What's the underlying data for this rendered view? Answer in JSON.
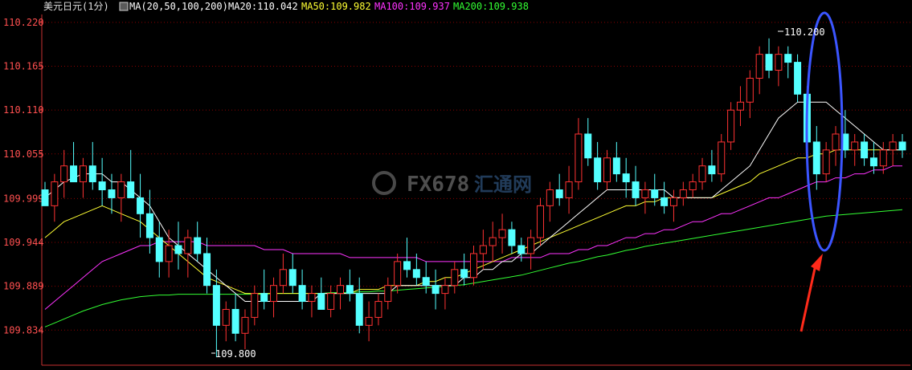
{
  "header": {
    "symbol_label": "美元日元(1分)",
    "ma_label": "MA(20,50,100,200)",
    "ma20_label": "MA20:110.042",
    "ma50_label": "MA50:109.982",
    "ma100_label": "MA100:109.937",
    "ma200_label": "MA200:109.938"
  },
  "watermark": {
    "text": "FX678",
    "cn": "汇通网"
  },
  "annotations": {
    "high_label": "110.200",
    "low_label": "109.800"
  },
  "chart_data": {
    "type": "candlestick",
    "title": "美元日元(1分)",
    "y_ticks": [
      "110.220",
      "110.165",
      "110.110",
      "110.055",
      "109.999",
      "109.944",
      "109.889",
      "109.834"
    ],
    "ylim": [
      109.79,
      110.23
    ],
    "grid": true,
    "colors": {
      "up": "#ff3232",
      "down": "#54ffff",
      "ma20": "#ffffff",
      "ma50": "#ffff33",
      "ma100": "#ff33ff",
      "ma200": "#33ff33",
      "axis": "#c83030",
      "grid": "#8c0000",
      "tick": "#ff5050",
      "circle": "#3b55ff",
      "arrow": "#ff2a1a"
    },
    "candles": [
      [
        110.01,
        110.02,
        109.99,
        109.99
      ],
      [
        109.99,
        110.03,
        109.97,
        110.02
      ],
      [
        110.02,
        110.06,
        110.0,
        110.04
      ],
      [
        110.04,
        110.07,
        110.02,
        110.02
      ],
      [
        110.02,
        110.05,
        110.0,
        110.04
      ],
      [
        110.04,
        110.07,
        110.01,
        110.02
      ],
      [
        110.02,
        110.05,
        109.99,
        110.01
      ],
      [
        110.01,
        110.03,
        109.98,
        110.0
      ],
      [
        110.0,
        110.03,
        109.97,
        110.02
      ],
      [
        110.02,
        110.06,
        110.0,
        110.0
      ],
      [
        110.0,
        110.03,
        109.95,
        109.98
      ],
      [
        109.98,
        110.01,
        109.93,
        109.95
      ],
      [
        109.95,
        109.97,
        109.9,
        109.92
      ],
      [
        109.92,
        109.96,
        109.9,
        109.94
      ],
      [
        109.94,
        109.97,
        109.91,
        109.93
      ],
      [
        109.93,
        109.96,
        109.9,
        109.95
      ],
      [
        109.95,
        109.97,
        109.92,
        109.93
      ],
      [
        109.93,
        109.95,
        109.88,
        109.89
      ],
      [
        109.89,
        109.91,
        109.8,
        109.84
      ],
      [
        109.84,
        109.87,
        109.82,
        109.86
      ],
      [
        109.86,
        109.88,
        109.82,
        109.83
      ],
      [
        109.83,
        109.86,
        109.81,
        109.85
      ],
      [
        109.85,
        109.89,
        109.84,
        109.88
      ],
      [
        109.88,
        109.91,
        109.86,
        109.87
      ],
      [
        109.87,
        109.9,
        109.85,
        109.89
      ],
      [
        109.89,
        109.93,
        109.88,
        109.91
      ],
      [
        109.91,
        109.93,
        109.88,
        109.89
      ],
      [
        109.89,
        109.91,
        109.86,
        109.87
      ],
      [
        109.87,
        109.89,
        109.85,
        109.88
      ],
      [
        109.88,
        109.9,
        109.86,
        109.86
      ],
      [
        109.86,
        109.89,
        109.85,
        109.88
      ],
      [
        109.88,
        109.9,
        109.86,
        109.89
      ],
      [
        109.89,
        109.91,
        109.87,
        109.88
      ],
      [
        109.88,
        109.9,
        109.83,
        109.84
      ],
      [
        109.84,
        109.87,
        109.82,
        109.85
      ],
      [
        109.85,
        109.88,
        109.84,
        109.87
      ],
      [
        109.87,
        109.9,
        109.86,
        109.89
      ],
      [
        109.89,
        109.93,
        109.88,
        109.92
      ],
      [
        109.92,
        109.95,
        109.9,
        109.91
      ],
      [
        109.91,
        109.93,
        109.89,
        109.9
      ],
      [
        109.9,
        109.92,
        109.88,
        109.89
      ],
      [
        109.89,
        109.91,
        109.86,
        109.88
      ],
      [
        109.88,
        109.9,
        109.86,
        109.89
      ],
      [
        109.89,
        109.92,
        109.88,
        109.91
      ],
      [
        109.91,
        109.93,
        109.89,
        109.9
      ],
      [
        109.9,
        109.94,
        109.89,
        109.93
      ],
      [
        109.93,
        109.96,
        109.91,
        109.94
      ],
      [
        109.94,
        109.97,
        109.92,
        109.95
      ],
      [
        109.95,
        109.98,
        109.93,
        109.96
      ],
      [
        109.96,
        109.97,
        109.93,
        109.94
      ],
      [
        109.94,
        109.95,
        109.92,
        109.93
      ],
      [
        109.93,
        109.96,
        109.91,
        109.95
      ],
      [
        109.95,
        110.0,
        109.94,
        109.99
      ],
      [
        109.99,
        110.02,
        109.97,
        110.01
      ],
      [
        110.01,
        110.03,
        109.99,
        110.0
      ],
      [
        110.0,
        110.04,
        109.98,
        110.02
      ],
      [
        110.02,
        110.1,
        110.01,
        110.08
      ],
      [
        110.08,
        110.1,
        110.04,
        110.05
      ],
      [
        110.05,
        110.07,
        110.01,
        110.02
      ],
      [
        110.02,
        110.06,
        110.01,
        110.05
      ],
      [
        110.05,
        110.07,
        110.02,
        110.03
      ],
      [
        110.03,
        110.05,
        110.0,
        110.02
      ],
      [
        110.02,
        110.04,
        109.99,
        110.0
      ],
      [
        110.0,
        110.02,
        109.98,
        110.01
      ],
      [
        110.01,
        110.03,
        109.99,
        110.0
      ],
      [
        110.0,
        110.02,
        109.98,
        109.99
      ],
      [
        109.99,
        110.01,
        109.97,
        110.0
      ],
      [
        110.0,
        110.02,
        109.99,
        110.01
      ],
      [
        110.01,
        110.03,
        110.0,
        110.02
      ],
      [
        110.02,
        110.05,
        110.01,
        110.04
      ],
      [
        110.04,
        110.06,
        110.02,
        110.03
      ],
      [
        110.03,
        110.08,
        110.02,
        110.07
      ],
      [
        110.07,
        110.12,
        110.06,
        110.11
      ],
      [
        110.11,
        110.14,
        110.09,
        110.12
      ],
      [
        110.12,
        110.16,
        110.1,
        110.15
      ],
      [
        110.15,
        110.19,
        110.13,
        110.18
      ],
      [
        110.18,
        110.2,
        110.15,
        110.16
      ],
      [
        110.16,
        110.19,
        110.14,
        110.18
      ],
      [
        110.18,
        110.19,
        110.15,
        110.17
      ],
      [
        110.17,
        110.18,
        110.12,
        110.13
      ],
      [
        110.13,
        110.14,
        110.05,
        110.07
      ],
      [
        110.07,
        110.09,
        110.01,
        110.03
      ],
      [
        110.03,
        110.07,
        110.02,
        110.06
      ],
      [
        110.06,
        110.09,
        110.04,
        110.08
      ],
      [
        110.08,
        110.11,
        110.05,
        110.06
      ],
      [
        110.06,
        110.08,
        110.04,
        110.07
      ],
      [
        110.07,
        110.08,
        110.04,
        110.05
      ],
      [
        110.05,
        110.07,
        110.03,
        110.04
      ],
      [
        110.04,
        110.07,
        110.03,
        110.06
      ],
      [
        110.06,
        110.08,
        110.04,
        110.07
      ],
      [
        110.07,
        110.08,
        110.05,
        110.06
      ]
    ],
    "ma20": [
      110.0,
      110.01,
      110.02,
      110.025,
      110.03,
      110.03,
      110.03,
      110.02,
      110.02,
      110.01,
      110.0,
      109.99,
      109.97,
      109.95,
      109.94,
      109.93,
      109.92,
      109.91,
      109.9,
      109.89,
      109.88,
      109.87,
      109.87,
      109.87,
      109.87,
      109.87,
      109.87,
      109.87,
      109.87,
      109.88,
      109.88,
      109.88,
      109.88,
      109.88,
      109.88,
      109.88,
      109.88,
      109.89,
      109.89,
      109.89,
      109.89,
      109.89,
      109.89,
      109.89,
      109.9,
      109.9,
      109.91,
      109.91,
      109.92,
      109.92,
      109.93,
      109.93,
      109.94,
      109.95,
      109.96,
      109.97,
      109.98,
      109.99,
      110.0,
      110.01,
      110.01,
      110.01,
      110.01,
      110.01,
      110.01,
      110.01,
      110.0,
      110.0,
      110.0,
      110.0,
      110.0,
      110.01,
      110.02,
      110.03,
      110.04,
      110.06,
      110.08,
      110.1,
      110.11,
      110.12,
      110.12,
      110.12,
      110.12,
      110.11,
      110.1,
      110.09,
      110.08,
      110.07,
      110.06,
      110.06,
      110.06
    ],
    "ma50": [
      109.95,
      109.96,
      109.97,
      109.975,
      109.98,
      109.985,
      109.99,
      109.985,
      109.98,
      109.975,
      109.97,
      109.96,
      109.95,
      109.94,
      109.93,
      109.92,
      109.91,
      109.9,
      109.895,
      109.89,
      109.885,
      109.88,
      109.88,
      109.88,
      109.88,
      109.88,
      109.88,
      109.88,
      109.88,
      109.88,
      109.88,
      109.88,
      109.88,
      109.885,
      109.885,
      109.885,
      109.89,
      109.89,
      109.89,
      109.89,
      109.895,
      109.895,
      109.9,
      109.9,
      109.905,
      109.91,
      109.915,
      109.92,
      109.925,
      109.93,
      109.935,
      109.94,
      109.945,
      109.95,
      109.955,
      109.96,
      109.965,
      109.97,
      109.975,
      109.98,
      109.985,
      109.99,
      109.99,
      109.995,
      109.995,
      110.0,
      110.0,
      110.0,
      110.0,
      110.0,
      110.0,
      110.005,
      110.01,
      110.015,
      110.02,
      110.03,
      110.035,
      110.04,
      110.045,
      110.05,
      110.05,
      110.055,
      110.055,
      110.06,
      110.06,
      110.06,
      110.06,
      110.06,
      110.06,
      110.06,
      110.06
    ],
    "ma100": [
      109.86,
      109.87,
      109.88,
      109.89,
      109.9,
      109.91,
      109.92,
      109.925,
      109.93,
      109.935,
      109.94,
      109.94,
      109.945,
      109.945,
      109.945,
      109.945,
      109.945,
      109.94,
      109.94,
      109.94,
      109.94,
      109.94,
      109.94,
      109.935,
      109.935,
      109.935,
      109.93,
      109.93,
      109.93,
      109.93,
      109.93,
      109.93,
      109.925,
      109.925,
      109.925,
      109.925,
      109.925,
      109.925,
      109.925,
      109.925,
      109.92,
      109.92,
      109.92,
      109.92,
      109.92,
      109.92,
      109.92,
      109.92,
      109.92,
      109.925,
      109.925,
      109.925,
      109.925,
      109.93,
      109.93,
      109.93,
      109.935,
      109.935,
      109.94,
      109.94,
      109.945,
      109.95,
      109.95,
      109.955,
      109.955,
      109.96,
      109.96,
      109.965,
      109.97,
      109.97,
      109.975,
      109.98,
      109.98,
      109.985,
      109.99,
      109.995,
      110.0,
      110.0,
      110.005,
      110.01,
      110.015,
      110.02,
      110.02,
      110.025,
      110.025,
      110.03,
      110.03,
      110.035,
      110.035,
      110.04,
      110.04
    ],
    "ma200": [
      109.838,
      109.843,
      109.848,
      109.853,
      109.858,
      109.862,
      109.866,
      109.869,
      109.872,
      109.874,
      109.876,
      109.877,
      109.878,
      109.878,
      109.879,
      109.879,
      109.879,
      109.879,
      109.879,
      109.879,
      109.879,
      109.879,
      109.879,
      109.879,
      109.88,
      109.88,
      109.88,
      109.88,
      109.88,
      109.88,
      109.881,
      109.881,
      109.881,
      109.882,
      109.882,
      109.883,
      109.883,
      109.884,
      109.885,
      109.886,
      109.887,
      109.888,
      109.889,
      109.89,
      109.891,
      109.893,
      109.895,
      109.897,
      109.899,
      109.901,
      109.903,
      109.906,
      109.909,
      109.912,
      109.915,
      109.918,
      109.92,
      109.923,
      109.926,
      109.928,
      109.931,
      109.934,
      109.936,
      109.939,
      109.941,
      109.943,
      109.945,
      109.947,
      109.949,
      109.951,
      109.953,
      109.955,
      109.957,
      109.959,
      109.961,
      109.963,
      109.965,
      109.967,
      109.969,
      109.971,
      109.973,
      109.975,
      109.977,
      109.978,
      109.979,
      109.98,
      109.981,
      109.982,
      109.983,
      109.984,
      109.985
    ]
  }
}
